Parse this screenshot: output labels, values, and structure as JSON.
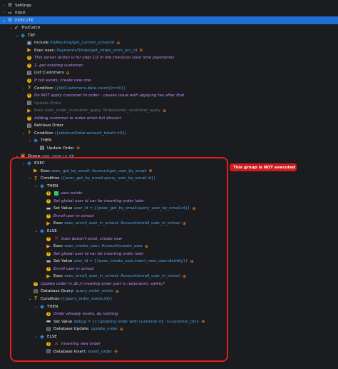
{
  "rows": [
    {
      "indent": 0,
      "tw": "›",
      "icon": "⚙",
      "iconClass": "gear",
      "iconName": "settings-gear-icon",
      "label": "Settings"
    },
    {
      "indent": 0,
      "tw": "›",
      "icon": "⇨",
      "iconClass": "gear",
      "iconName": "input-icon",
      "label": "Input"
    },
    {
      "indent": 0,
      "tw": "⌄",
      "icon": "⚙",
      "iconClass": "gear",
      "iconName": "execute-icon",
      "label": "EXECUTE",
      "hl": true
    },
    {
      "indent": 1,
      "tw": "⌄",
      "icon": "✔",
      "iconClass": "orange",
      "iconName": "try-catch-icon",
      "label": "Try/Catch"
    },
    {
      "indent": 2,
      "tw": "⌄",
      "icon": "◈",
      "iconClass": "blue",
      "iconName": "try-block-icon",
      "label": "TRY"
    },
    {
      "indent": 3,
      "tw": "",
      "icon": "▣",
      "iconClass": "folder",
      "iconName": "include-icon",
      "label": "Include",
      "value": "lib/Routing/get_current_schoolid",
      "link": true
    },
    {
      "indent": 3,
      "tw": "",
      "icon": "▶",
      "iconClass": "orange",
      "iconName": "exec-icon",
      "label": "Exec exec:",
      "value": "Payments/Stripe/get_stripe_conn_acc_id",
      "link": true
    },
    {
      "indent": 3,
      "tw": "",
      "icon": "i",
      "iconClass": "info",
      "iconName": "comment-info-icon",
      "comment": "This server action is for step 1/2 in the checkout (one time payments)"
    },
    {
      "indent": 3,
      "tw": "",
      "icon": "i",
      "iconClass": "info",
      "iconName": "comment-info-icon",
      "comment": "1. get existing customer"
    },
    {
      "indent": 3,
      "tw": "",
      "icon": "▤",
      "iconClass": "doc",
      "iconName": "list-icon",
      "label": "List Customers",
      "link": true
    },
    {
      "indent": 3,
      "tw": "",
      "icon": "i",
      "iconClass": "info",
      "iconName": "comment-info-icon",
      "comment": "If not exists, create new one"
    },
    {
      "indent": 3,
      "tw": "›",
      "icon": "?",
      "iconClass": "orange",
      "iconName": "condition-icon",
      "label": "Condition",
      "value": "({listCustomers.data.count()==0})"
    },
    {
      "indent": 3,
      "tw": "",
      "icon": "i",
      "iconClass": "info",
      "iconName": "comment-info-icon",
      "comment": "Do NOT apply customer to order - causes issue with applying tax after that"
    },
    {
      "indent": 3,
      "tw": "",
      "icon": "▤",
      "iconClass": "doc",
      "iconName": "update-icon",
      "label": "Update Order",
      "muted": true
    },
    {
      "indent": 3,
      "tw": "",
      "icon": "▶",
      "iconClass": "orange",
      "iconName": "exec-icon",
      "label": "Exec exec_order_customer_apply:",
      "value": "Stripe/order_customer_apply",
      "muted": true,
      "link": true
    },
    {
      "indent": 3,
      "tw": "",
      "icon": "i",
      "iconClass": "info",
      "iconName": "comment-info-icon",
      "comment": "Adding customer to order when full dicount"
    },
    {
      "indent": 3,
      "tw": "",
      "icon": "▤",
      "iconClass": "doc",
      "iconName": "retrieve-icon",
      "label": "Retrieve Order"
    },
    {
      "indent": 3,
      "tw": "⌄",
      "icon": "?",
      "iconClass": "orange",
      "iconName": "condition-icon",
      "label": "Condition",
      "value": "({retrieveOrder.amount_total==0})"
    },
    {
      "indent": 4,
      "tw": "⌄",
      "icon": "◈",
      "iconClass": "blue",
      "iconName": "then-icon",
      "label": "THEN"
    },
    {
      "indent": 5,
      "tw": "",
      "icon": "▤",
      "iconClass": "doc",
      "iconName": "update-icon",
      "label": "Update Order",
      "link": true
    },
    {
      "indent": 2,
      "tw": "⌄",
      "icon": "▣",
      "iconClass": "grp",
      "iconName": "group-icon",
      "label": "Group",
      "value": "user_save_in_db"
    },
    {
      "indent": 3,
      "tw": "⌄",
      "icon": "◈",
      "iconClass": "blue",
      "iconName": "exec-block-icon",
      "label": "EXEC"
    },
    {
      "indent": 4,
      "tw": "",
      "icon": "▶",
      "iconClass": "orange",
      "iconName": "exec-icon",
      "label": "Exec",
      "value": "exec_get_by_email:",
      "value2": "Account/get_user_by_email",
      "link": true
    },
    {
      "indent": 4,
      "tw": "⌄",
      "icon": "?",
      "iconClass": "orange",
      "iconName": "condition-icon",
      "label": "Condition",
      "value": "({exec_get_by_email.query_user_by_email.id})"
    },
    {
      "indent": 5,
      "tw": "⌄",
      "icon": "◈",
      "iconClass": "blue",
      "iconName": "then-icon",
      "label": "THEN"
    },
    {
      "indent": 6,
      "tw": "",
      "icon": "i",
      "iconClass": "info",
      "iconName": "comment-info-icon",
      "green": true,
      "comment": "user exists"
    },
    {
      "indent": 6,
      "tw": "",
      "icon": "i",
      "iconClass": "info",
      "iconName": "comment-info-icon",
      "comment": "Set global user id var for inserting order later"
    },
    {
      "indent": 6,
      "tw": "",
      "icon": "▬",
      "iconClass": "db",
      "iconName": "set-value-icon",
      "label": "Set Value",
      "value": "user_id = {{exec_get_by_email.query_user_by_email.id}}",
      "link": true
    },
    {
      "indent": 6,
      "tw": "",
      "icon": "i",
      "iconClass": "info",
      "iconName": "comment-info-icon",
      "comment": "Enroll user in school"
    },
    {
      "indent": 6,
      "tw": "",
      "icon": "▶",
      "iconClass": "orange",
      "iconName": "exec-icon",
      "label": "Exec",
      "value": "exec_enroll_user_in_school:",
      "value2": "Account/enroll_user_in_school",
      "link": true
    },
    {
      "indent": 5,
      "tw": "⌄",
      "icon": "◈",
      "iconClass": "blue",
      "iconName": "else-icon",
      "label": "ELSE"
    },
    {
      "indent": 6,
      "tw": "",
      "icon": "i",
      "iconClass": "info",
      "iconName": "comment-info-icon",
      "red": true,
      "comment": "User doesn't exist, create new"
    },
    {
      "indent": 6,
      "tw": "",
      "icon": "▶",
      "iconClass": "orange",
      "iconName": "exec-icon",
      "label": "Exec",
      "value": "exec_create_user:",
      "value2": "Account/create_user",
      "link": true
    },
    {
      "indent": 6,
      "tw": "",
      "icon": "i",
      "iconClass": "info",
      "iconName": "comment-info-icon",
      "comment": "Set global user id var for inserting order later"
    },
    {
      "indent": 6,
      "tw": "",
      "icon": "▬",
      "iconClass": "db",
      "iconName": "set-value-icon",
      "label": "Set Value",
      "value": "user_id = {{exec_create_user.insert_new_user.identity}}",
      "link": true
    },
    {
      "indent": 6,
      "tw": "",
      "icon": "i",
      "iconClass": "info",
      "iconName": "comment-info-icon",
      "comment": "Enroll user in school"
    },
    {
      "indent": 6,
      "tw": "",
      "icon": "▶",
      "iconClass": "orange",
      "iconName": "exec-icon",
      "label": "Exec",
      "value": "exec_enroll_user_in_school:",
      "value2": "Account/enroll_user_in_school",
      "link": true
    },
    {
      "indent": 4,
      "tw": "",
      "icon": "i",
      "iconClass": "info",
      "iconName": "comment-info-icon",
      "comment": "Update order in db // creating order part is redundant, safety?"
    },
    {
      "indent": 4,
      "tw": "",
      "icon": "▤",
      "iconClass": "db",
      "iconName": "database-query-icon",
      "label": "Database Query:",
      "value": "query_order_exists",
      "link": true
    },
    {
      "indent": 4,
      "tw": "⌄",
      "icon": "?",
      "iconClass": "orange",
      "iconName": "condition-icon",
      "label": "Condition",
      "value": "({query_order_exists.id})"
    },
    {
      "indent": 5,
      "tw": "⌄",
      "icon": "◈",
      "iconClass": "blue",
      "iconName": "then-icon",
      "label": "THEN"
    },
    {
      "indent": 6,
      "tw": "",
      "icon": "i",
      "iconClass": "info",
      "iconName": "comment-info-icon",
      "comment": "Order already exists, do nothing"
    },
    {
      "indent": 6,
      "tw": "",
      "icon": "▬",
      "iconClass": "db",
      "iconName": "set-value-icon",
      "label": "Set Value",
      "value": "debug = {{'updating order with customer id: '+customer_id}}",
      "link": true
    },
    {
      "indent": 6,
      "tw": "",
      "icon": "▤",
      "iconClass": "db",
      "iconName": "database-update-icon",
      "label": "Database Update:",
      "value": "update_order",
      "link": true
    },
    {
      "indent": 5,
      "tw": "⌄",
      "icon": "◈",
      "iconClass": "blue",
      "iconName": "else-icon",
      "label": "ELSE"
    },
    {
      "indent": 6,
      "tw": "",
      "icon": "i",
      "iconClass": "info",
      "iconName": "comment-info-icon",
      "red": true,
      "comment": "Inserting new order"
    },
    {
      "indent": 6,
      "tw": "",
      "icon": "▤",
      "iconClass": "db",
      "iconName": "database-insert-icon",
      "label": "Database Insert:",
      "value": "insert_order",
      "link": true
    }
  ],
  "banner": "This group is NOT executed",
  "colors": {
    "highlight": "#1f6fd6",
    "annotation": "#e01e1e",
    "comment": "#c48cff",
    "value": "#4fa3e8"
  },
  "link_icon": "⊕"
}
